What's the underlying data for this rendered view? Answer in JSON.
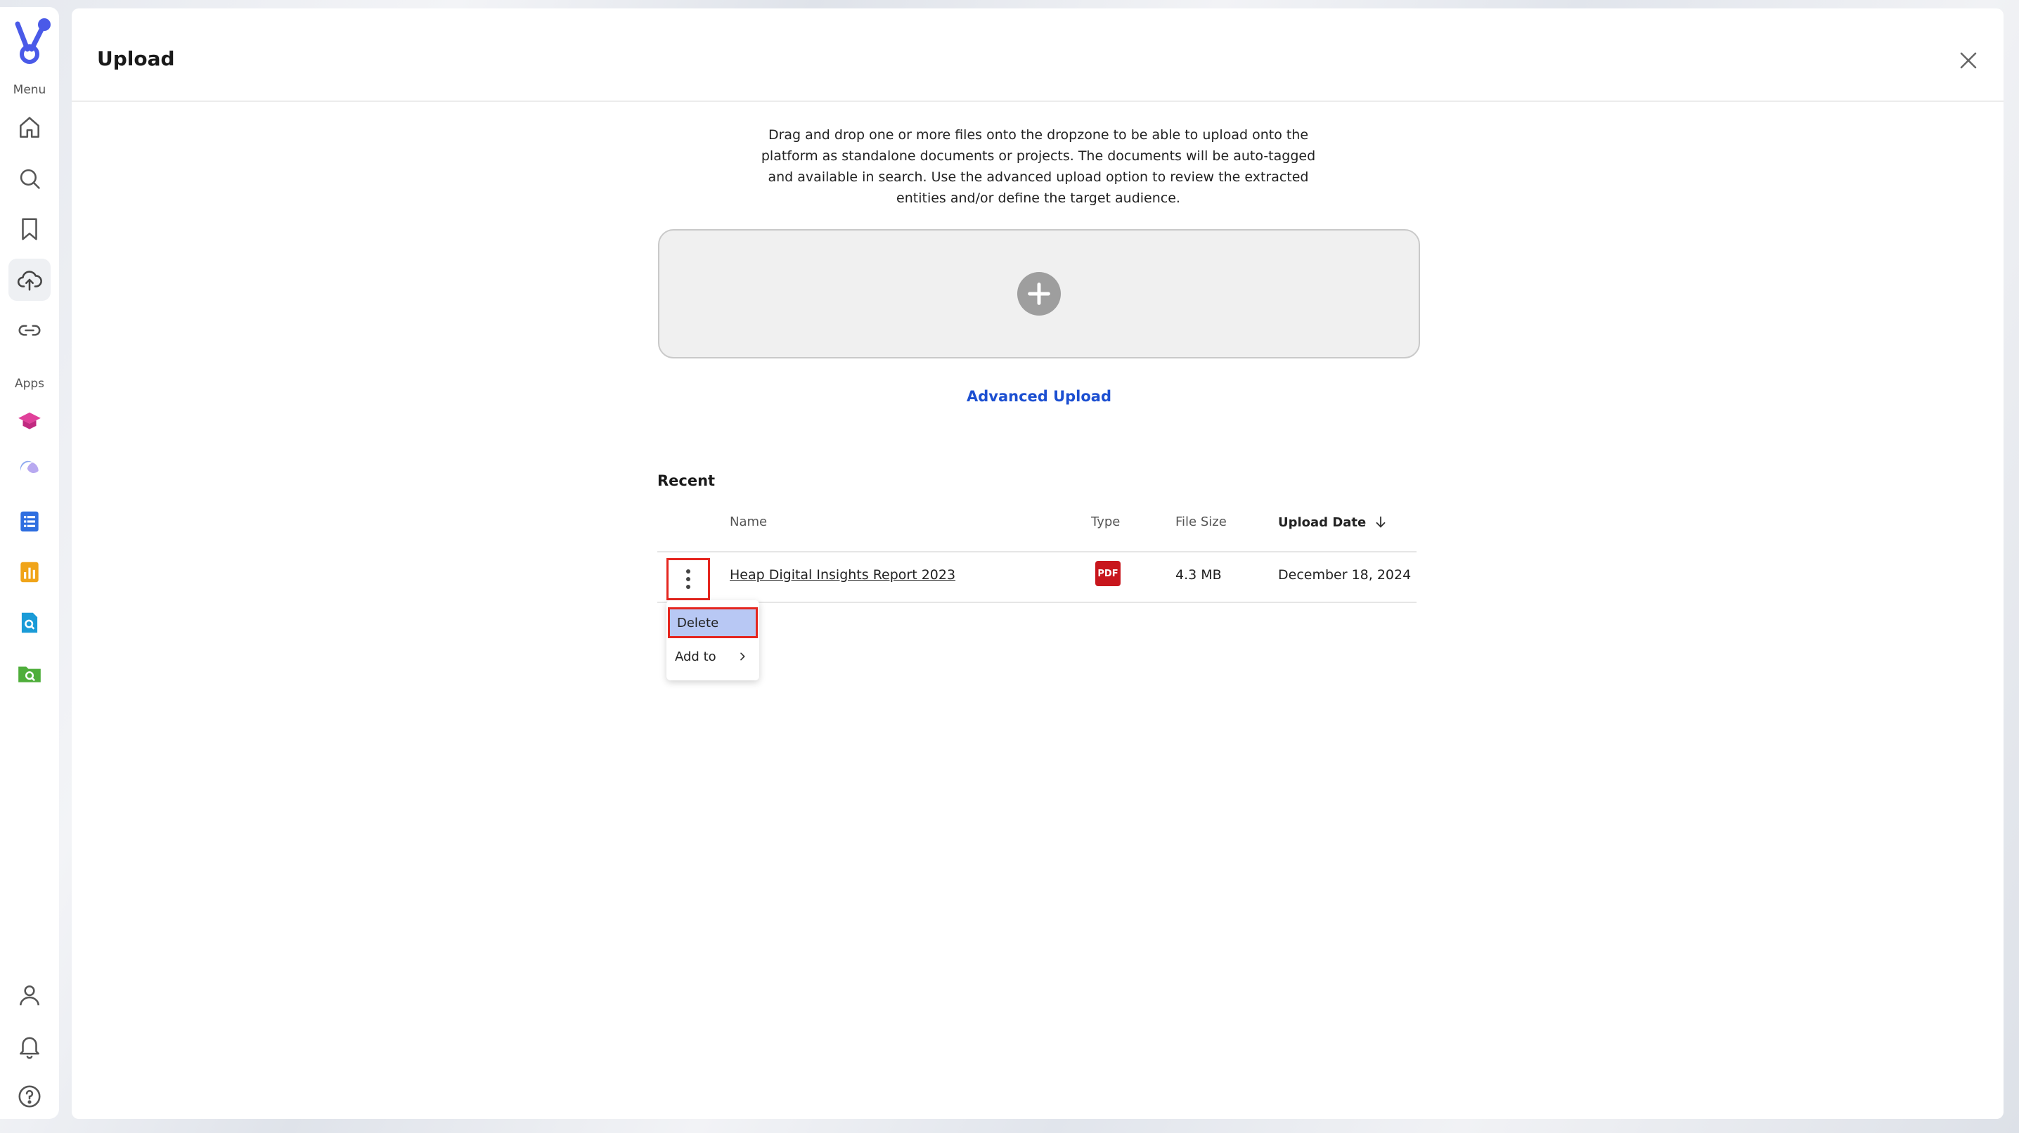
{
  "sidebar": {
    "menu_label": "Menu",
    "apps_label": "Apps",
    "nav_items": [
      "home-icon",
      "search-icon",
      "bookmark-icon",
      "cloud-upload-icon",
      "link-icon"
    ],
    "app_items": [
      "graduation-cap-icon",
      "moon-icon",
      "document-list-icon",
      "bar-chart-icon",
      "file-search-icon",
      "folder-search-icon"
    ],
    "bottom_items": [
      "user-icon",
      "bell-icon",
      "help-icon"
    ],
    "brand_color": "#4a5ae8"
  },
  "header": {
    "title": "Upload"
  },
  "upload": {
    "description": "Drag and drop one or more files onto the dropzone to be able to upload onto the platform as standalone documents or projects. The documents will be auto-tagged and available in search. Use the advanced upload option to review the extracted entities and/or define the target audience.",
    "advanced_upload_label": "Advanced Upload"
  },
  "recent": {
    "title": "Recent",
    "columns": {
      "name": "Name",
      "type": "Type",
      "file_size": "File Size",
      "upload_date": "Upload Date"
    },
    "rows": [
      {
        "name": "Heap Digital Insights Report 2023",
        "type": "PDF",
        "file_size": "4.3 MB",
        "upload_date": "December 18, 2024"
      }
    ]
  },
  "context_menu": {
    "delete_label": "Delete",
    "add_to_label": "Add to"
  }
}
